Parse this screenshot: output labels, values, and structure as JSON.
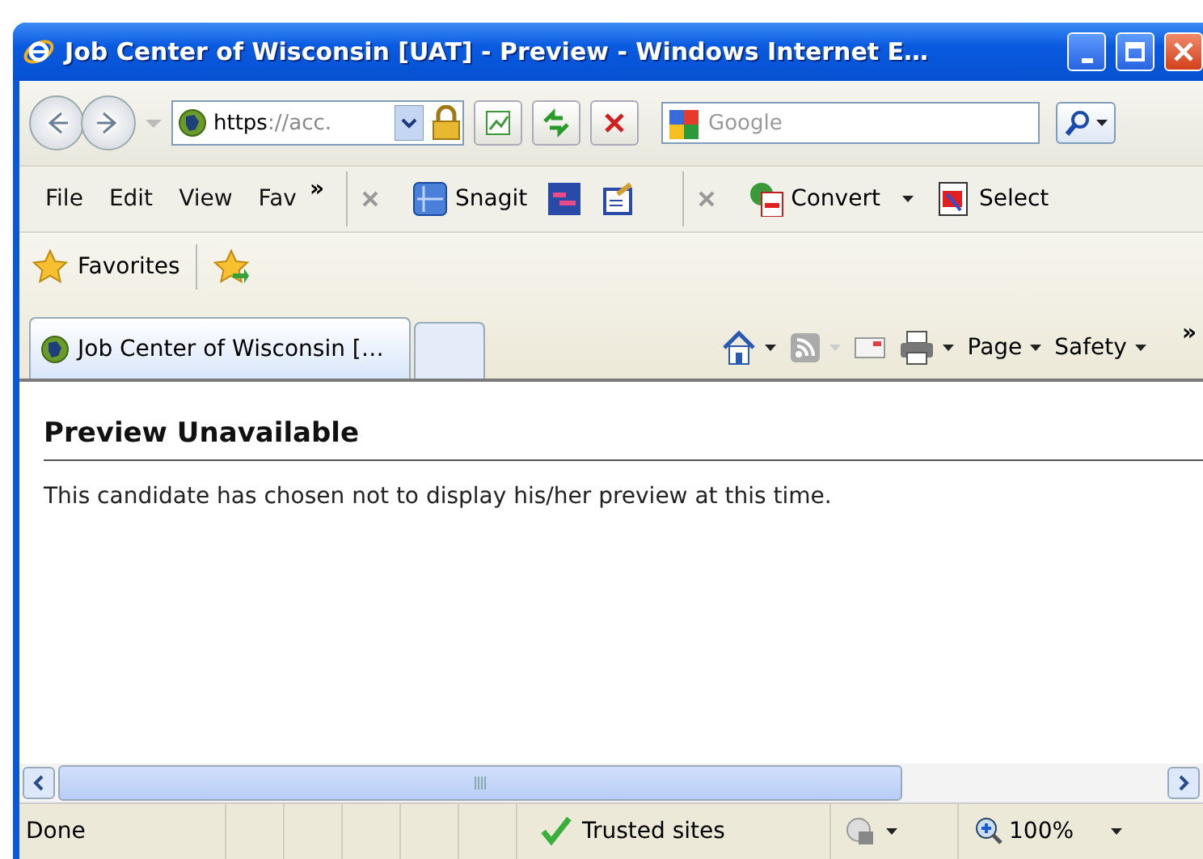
{
  "window": {
    "title": "Job Center of Wisconsin [UAT] - Preview - Windows Internet E…"
  },
  "address_bar": {
    "scheme": "https",
    "rest": "://acc."
  },
  "search": {
    "placeholder": "Google"
  },
  "menu": [
    "File",
    "Edit",
    "View",
    "Fav"
  ],
  "toolbar": {
    "overflow": "»",
    "snagit": "Snagit",
    "convert": "Convert",
    "select": "Select"
  },
  "favorites_bar": {
    "label": "Favorites"
  },
  "tabs": [
    {
      "label": "Job Center of Wisconsin […",
      "selected": true
    }
  ],
  "command_bar": {
    "page": "Page",
    "safety": "Safety",
    "overflow": "»"
  },
  "content": {
    "heading": "Preview Unavailable",
    "message": "This candidate has chosen not to display his/her preview at this time."
  },
  "status_bar": {
    "text": "Done",
    "zone": "Trusted sites",
    "zoom": "100%"
  }
}
